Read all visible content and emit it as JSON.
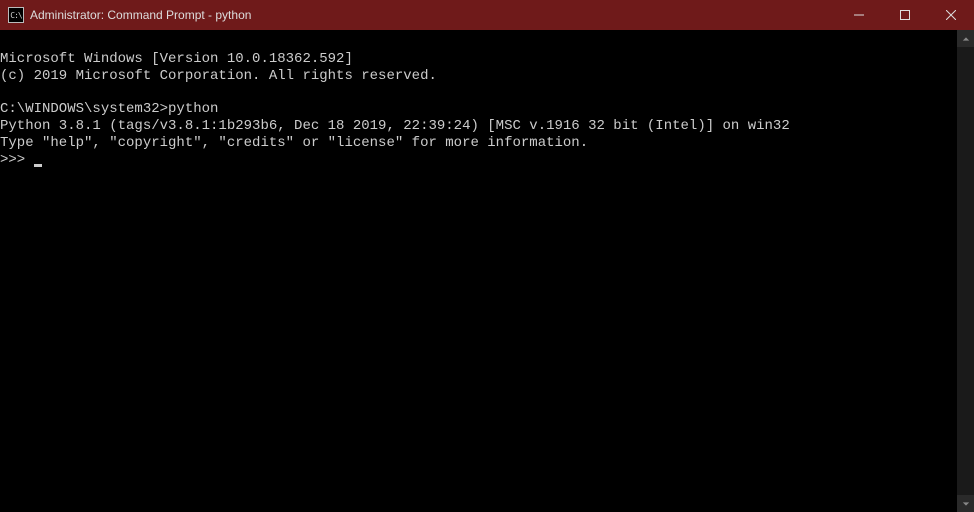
{
  "window": {
    "title": "Administrator: Command Prompt - python"
  },
  "terminal": {
    "line1": "Microsoft Windows [Version 10.0.18362.592]",
    "line2": "(c) 2019 Microsoft Corporation. All rights reserved.",
    "blank1": "",
    "prompt_path": "C:\\WINDOWS\\system32>",
    "command": "python",
    "py_version": "Python 3.8.1 (tags/v3.8.1:1b293b6, Dec 18 2019, 22:39:24) [MSC v.1916 32 bit (Intel)] on win32",
    "py_help": "Type \"help\", \"copyright\", \"credits\" or \"license\" for more information.",
    "repl_prompt": ">>> "
  }
}
